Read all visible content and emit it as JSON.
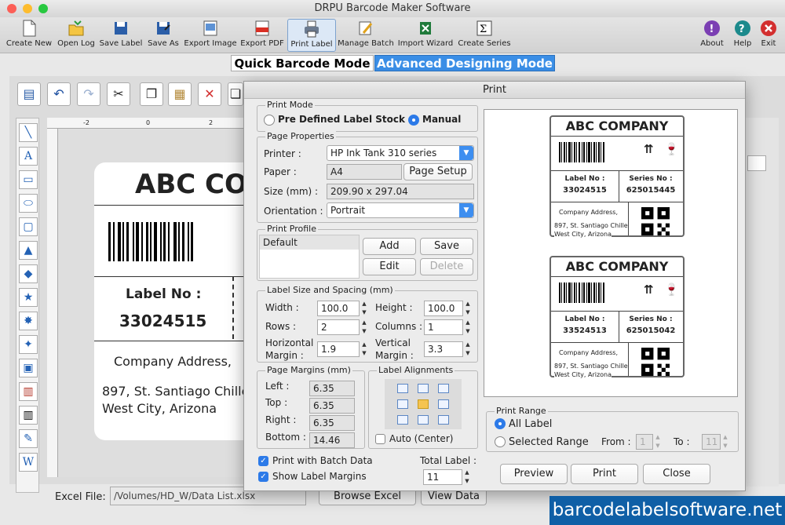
{
  "window": {
    "title": "DRPU Barcode Maker Software"
  },
  "toolbar": {
    "create_new": "Create New",
    "open_log": "Open Log",
    "save_label": "Save Label",
    "save_as": "Save As",
    "export_image": "Export Image",
    "export_pdf": "Export PDF",
    "print_label": "Print Label",
    "manage_batch": "Manage Batch",
    "import_wizard": "Import Wizard",
    "create_series": "Create Series",
    "about": "About",
    "help": "Help",
    "exit": "Exit"
  },
  "modes": {
    "quick": "Quick Barcode Mode",
    "advanced": "Advanced Designing Mode"
  },
  "ruler": {
    "h": [
      "-2",
      "0",
      "2"
    ]
  },
  "label": {
    "company": "ABC COMPANY",
    "label_no_title": "Label No :",
    "label_no": "33024515",
    "address_title": "Company Address,",
    "address_line1": "897, St. Santiago Chille",
    "address_line2": "West City, Arizona"
  },
  "bottom": {
    "excel_file_label": "Excel File:",
    "excel_path": "/Volumes/HD_W/Data List.xlsx",
    "browse_excel": "Browse Excel",
    "view_data": "View Data"
  },
  "dialog": {
    "title": "Print",
    "print_mode": {
      "title": "Print Mode",
      "predefined": "Pre Defined Label Stock",
      "manual": "Manual"
    },
    "page_properties": {
      "title": "Page Properties",
      "printer_label": "Printer :",
      "printer": "HP Ink Tank 310 series",
      "paper_label": "Paper :",
      "paper": "A4",
      "page_setup": "Page Setup",
      "size_label": "Size (mm) :",
      "size": "209.90 x 297.04",
      "orientation_label": "Orientation :",
      "orientation": "Portrait"
    },
    "print_profile": {
      "title": "Print Profile",
      "items": [
        "Default"
      ],
      "add": "Add",
      "save": "Save",
      "edit": "Edit",
      "delete": "Delete"
    },
    "label_size": {
      "title": "Label Size and Spacing (mm)",
      "width_label": "Width :",
      "width": "100.0",
      "height_label": "Height :",
      "height": "100.0",
      "rows_label": "Rows :",
      "rows": "2",
      "columns_label": "Columns :",
      "columns": "1",
      "hmargin_label1": "Horizontal",
      "hmargin_label2": "Margin :",
      "hmargin": "1.9",
      "vmargin_label1": "Vertical",
      "vmargin_label2": "Margin :",
      "vmargin": "3.3"
    },
    "page_margins": {
      "title": "Page Margins (mm)",
      "left_label": "Left :",
      "left": "6.35",
      "top_label": "Top :",
      "top": "6.35",
      "right_label": "Right :",
      "right": "6.35",
      "bottom_label": "Bottom :",
      "bottom": "14.46"
    },
    "label_alignments": {
      "title": "Label Alignments",
      "auto_center": "Auto (Center)"
    },
    "print_with_batch": "Print with Batch Data",
    "show_margins": "Show Label Margins",
    "total_label_title": "Total Label :",
    "total_label": "11",
    "print_range": {
      "title": "Print Range",
      "all": "All Label",
      "selected": "Selected Range",
      "from_label": "From :",
      "from": "1",
      "to_label": "To :",
      "to": "11"
    },
    "preview_btn": "Preview",
    "print_btn": "Print",
    "close_btn": "Close",
    "preview_labels": [
      {
        "company": "ABC COMPANY",
        "label_no_title": "Label No :",
        "label_no": "33024515",
        "series_no_title": "Series No :",
        "series_no": "625015445",
        "address_title": "Company Address,",
        "address_line1": "897, St. Santiago Chille",
        "address_line2": "West City, Arizona"
      },
      {
        "company": "ABC COMPANY",
        "label_no_title": "Label No :",
        "label_no": "33524513",
        "series_no_title": "Series No :",
        "series_no": "625015042",
        "address_title": "Company Address,",
        "address_line1": "897, St. Santiago Chille",
        "address_line2": "West City, Arizona"
      }
    ]
  },
  "brand": "barcodelabelsoftware.net"
}
